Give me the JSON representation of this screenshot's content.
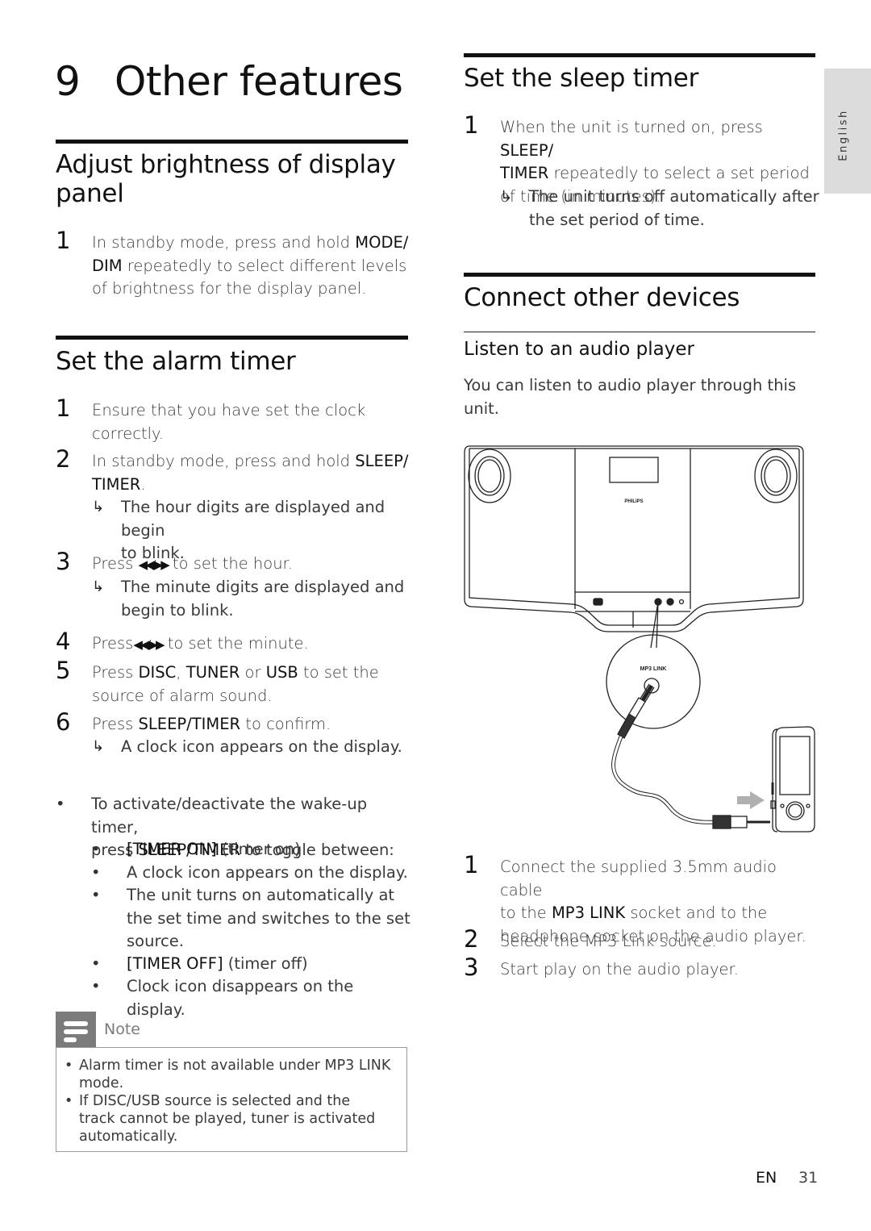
{
  "chapter": {
    "number": "9",
    "title": "Other features"
  },
  "brightness": {
    "heading": "Adjust brightness of display panel",
    "steps": [
      {
        "n": "1",
        "parts": [
          {
            "t": "In standby mode, press and hold "
          },
          {
            "b": "MODE/ DIM"
          },
          {
            "t": " repeatedly to select different levels of brightness for the display panel."
          }
        ]
      }
    ]
  },
  "alarm": {
    "heading": "Set the alarm timer",
    "steps": [
      {
        "n": "1",
        "line1": "Ensure that you have set the clock",
        "line2": "correctly."
      },
      {
        "n": "2",
        "line1_pre": "In standby mode, press and hold ",
        "line1_bold": "SLEEP/",
        "line2_bold": "TIMER",
        "line2_post": ".",
        "result": {
          "line1": "The hour digits are displayed and begin",
          "line2": "to blink."
        }
      },
      {
        "n": "3",
        "pre": "Press ",
        "icon": "rewind-forward-icon",
        "post": " to set the hour.",
        "result": {
          "line1": "The minute digits are displayed and",
          "line2": "begin to blink."
        }
      },
      {
        "n": "4",
        "pre": "Press",
        "icon": "rewind-forward-icon",
        "post": " to set the minute."
      },
      {
        "n": "5",
        "pre": "Press ",
        "b1": "DISC",
        "sep1": ", ",
        "b2": "TUNER",
        "sep2": " or ",
        "b3": "USB",
        "post": " to set the",
        "line2": "source of alarm sound."
      },
      {
        "n": "6",
        "pre": "Press ",
        "bold": "SLEEP/TIMER",
        "post": " to confirm.",
        "result": {
          "line1": "A clock icon appears on the display."
        }
      }
    ],
    "toggle": {
      "line1": "To activate/deactivate the wake-up timer,",
      "line2_pre": "press ",
      "line2_bold": "SLEEP/TIMER",
      "line2_post": " to toggle between:",
      "items": [
        {
          "bold": "[TIMER ON]",
          "text": " (timer on)"
        },
        {
          "text": "A clock icon appears on the display."
        },
        {
          "line1": "The unit turns on automatically at",
          "line2": "the set time and switches to the set",
          "line3": "source."
        },
        {
          "bold": "[TIMER OFF]",
          "text": " (timer off)"
        },
        {
          "text": "Clock icon disappears on the display."
        }
      ]
    },
    "note": {
      "label": "Note",
      "items": [
        {
          "line1": "Alarm timer is not available under MP3 LINK",
          "line2": "mode."
        },
        {
          "line1": "If DISC/USB source is selected and the",
          "line2": "track cannot be played, tuner is activated",
          "line3": "automatically."
        }
      ]
    }
  },
  "sleep": {
    "heading": "Set the sleep timer",
    "step": {
      "n": "1",
      "line1_pre": "When the unit is turned on, press ",
      "line1_bold": "SLEEP/",
      "line2_bold": "TIMER",
      "line2_post": " repeatedly to select a set period",
      "line3": "of time (in minutes).",
      "result": {
        "line1": "The unit turns off automatically after",
        "line2": "the set period of time."
      }
    }
  },
  "connect": {
    "heading": "Connect other devices",
    "subheading": "Listen to an audio player",
    "intro_line1": "You can listen to audio player through this",
    "intro_line2": "unit.",
    "illustration": {
      "brand": "PHILIPS",
      "socket_label": "MP3 LINK"
    },
    "steps": [
      {
        "n": "1",
        "line1": "Connect the supplied 3.5mm audio cable",
        "line2_pre": "to the ",
        "line2_bold": "MP3 LINK",
        "line2_post": " socket and to the",
        "line3": "headphone socket on the audio player."
      },
      {
        "n": "2",
        "text": "Select the MP3 Link source."
      },
      {
        "n": "3",
        "text": "Start play on the audio player."
      }
    ]
  },
  "side_tab": {
    "label": "English"
  },
  "footer": {
    "lang": "EN",
    "page": "31"
  },
  "symbols": {
    "arrow": "↳",
    "bullet": "•",
    "ffrw": "◀◀/▶▶"
  }
}
